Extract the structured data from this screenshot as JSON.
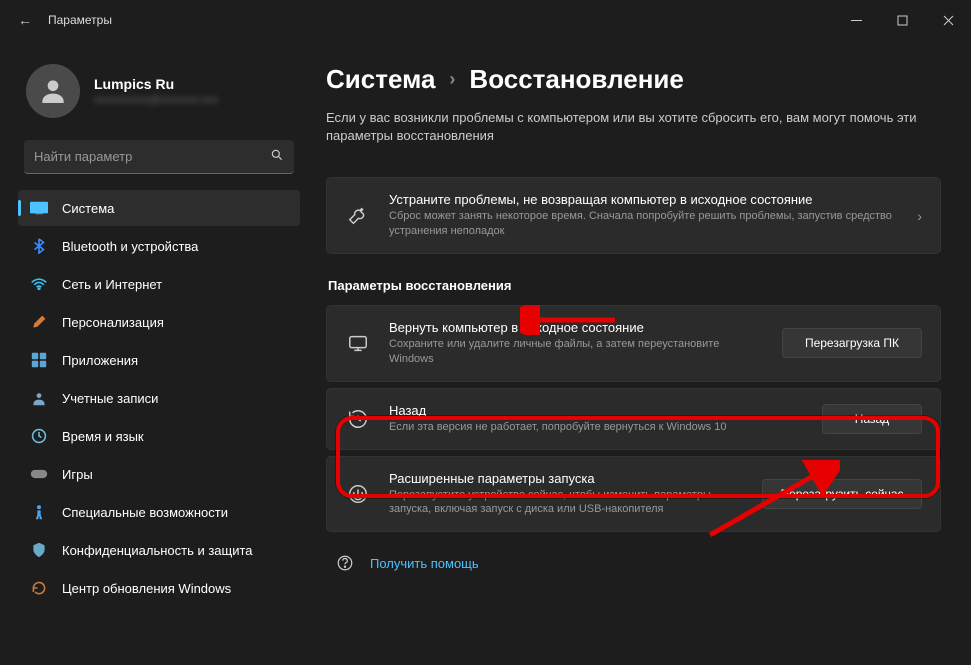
{
  "window": {
    "title": "Параметры"
  },
  "user": {
    "name": "Lumpics Ru",
    "email": "xxxxxxxxxx@xxxxxxx.xxx"
  },
  "search": {
    "placeholder": "Найти параметр"
  },
  "nav": {
    "system": "Система",
    "bluetooth": "Bluetooth и устройства",
    "network": "Сеть и Интернет",
    "personalization": "Персонализация",
    "apps": "Приложения",
    "accounts": "Учетные записи",
    "time": "Время и язык",
    "gaming": "Игры",
    "accessibility": "Специальные возможности",
    "privacy": "Конфиденциальность и защита",
    "update": "Центр обновления Windows"
  },
  "breadcrumb": {
    "parent": "Система",
    "current": "Восстановление"
  },
  "subtitle": "Если у вас возникли проблемы с компьютером или вы хотите сбросить его, вам могут помочь эти параметры восстановления",
  "troubleshoot": {
    "title": "Устраните проблемы, не возвращая компьютер в исходное состояние",
    "desc": "Сброс может занять некоторое время. Сначала попробуйте решить проблемы, запустив средство устранения неполадок"
  },
  "section_recovery": "Параметры восстановления",
  "reset": {
    "title": "Вернуть компьютер в исходное состояние",
    "desc": "Сохраните или удалите личные файлы, а затем переустановите Windows",
    "button": "Перезагрузка ПК"
  },
  "goback": {
    "title": "Назад",
    "desc": "Если эта версия не работает, попробуйте вернуться к Windows 10",
    "button": "Назад"
  },
  "advanced": {
    "title": "Расширенные параметры запуска",
    "desc": "Перезапустите устройство сейчас, чтобы изменить параметры запуска, включая запуск с диска или USB-накопителя",
    "button": "Перезагрузить сейчас"
  },
  "help": "Получить помощь"
}
